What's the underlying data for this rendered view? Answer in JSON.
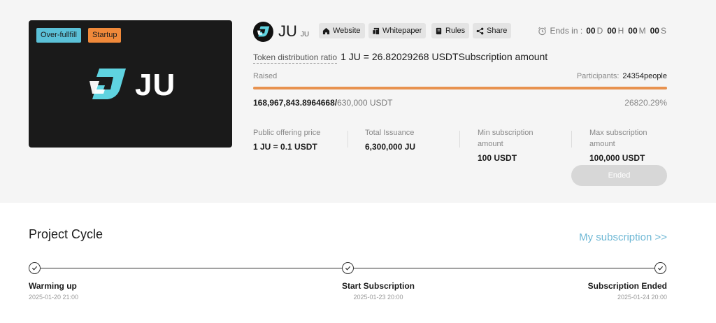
{
  "banner": {
    "tags": [
      "Over-fullfill",
      "Startup"
    ],
    "logo_text": "JU",
    "icon": "ju-logo-icon"
  },
  "header": {
    "name": "JU",
    "symbol": "JU",
    "links": [
      {
        "label": "Website",
        "icon": "home-icon"
      },
      {
        "label": "Whitepaper",
        "icon": "document-icon"
      },
      {
        "label": "Rules",
        "icon": "book-icon"
      },
      {
        "label": "Share",
        "icon": "share-icon"
      }
    ],
    "countdown": {
      "label": "Ends in :",
      "days": "00",
      "d": "D",
      "hours": "00",
      "h": "H",
      "minutes": "00",
      "m": "M",
      "seconds": "00",
      "s": "S"
    }
  },
  "ratio": {
    "label": "Token distribution ratio",
    "value": "1 JU = 26.82029268 USDTSubscription amount"
  },
  "raise": {
    "label": "Raised",
    "participants_label": "Participants:",
    "participants_value": "24354people",
    "raised_amount": "168,967,843.8964668/",
    "target": "630,000 USDT",
    "percent": "26820.29%",
    "progress": 1.0
  },
  "stats": [
    {
      "label": "Public offering price",
      "value": "1 JU = 0.1 USDT"
    },
    {
      "label": "Total Issuance",
      "value": "6,300,000 JU"
    },
    {
      "label": "Min subscription amount",
      "value": "100 USDT"
    },
    {
      "label": "Max subscription amount",
      "value": "100,000 USDT"
    }
  ],
  "ended_button": "Ended",
  "cycle": {
    "title": "Project Cycle",
    "my_subscription": "My subscription >>",
    "steps": [
      {
        "title": "Warming up",
        "date": "2025-01-20 21:00"
      },
      {
        "title": "Start Subscription",
        "date": "2025-01-23 20:00"
      },
      {
        "title": "Subscription Ended",
        "date": "2025-01-24 20:00"
      }
    ]
  },
  "colors": {
    "accent_blue": "#6fb8d5",
    "tag_over": "#5bc1d8",
    "tag_startup": "#f0893a",
    "progress": "#e8924f",
    "logo_cyan": "#5fd3e0"
  }
}
